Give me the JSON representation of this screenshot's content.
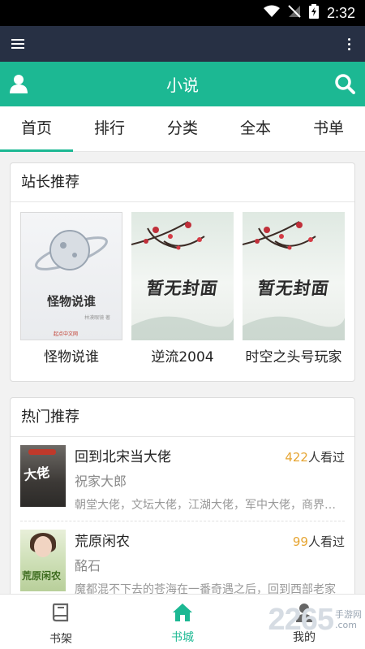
{
  "status_bar": {
    "time": "2:32"
  },
  "header": {
    "title": "小说"
  },
  "tabs": [
    {
      "label": "首页",
      "active": true
    },
    {
      "label": "排行",
      "active": false
    },
    {
      "label": "分类",
      "active": false
    },
    {
      "label": "全本",
      "active": false
    },
    {
      "label": "书单",
      "active": false
    }
  ],
  "recommend": {
    "title": "站长推荐",
    "books": [
      {
        "name": "怪物说谁",
        "cover_title": "怪物说谁",
        "cover_author": "林漠眼镜 著",
        "cover_publisher": "起点中文网"
      },
      {
        "name": "逆流2004",
        "cover_text": "暂无封面"
      },
      {
        "name": "时空之头号玩家",
        "cover_text": "暂无封面"
      }
    ]
  },
  "hot": {
    "title": "热门推荐",
    "items": [
      {
        "title": "回到北宋当大佬",
        "count": "422",
        "count_suffix": "人看过",
        "author": "祝家大郎",
        "desc": "朝堂大佬，文坛大佬，江湖大佬，军中大佬，商界大佬",
        "cover_text": "大佬"
      },
      {
        "title": "荒原闲农",
        "count": "99",
        "count_suffix": "人看过",
        "author": "酩石",
        "desc": "魔都混不下去的苍海在一番奇遇之后，回到西部老家",
        "cover_text": "荒原闲农"
      }
    ]
  },
  "bottom_nav": [
    {
      "label": "书架",
      "icon": "book-icon",
      "active": false
    },
    {
      "label": "书城",
      "icon": "home-icon",
      "active": true
    },
    {
      "label": "我的",
      "icon": "person-icon",
      "active": false
    }
  ],
  "watermark": {
    "number": "2265",
    "line1": "手游网",
    "line2": ".com"
  },
  "colors": {
    "accent": "#1cb893",
    "appbar": "#273044",
    "count": "#e6a532"
  }
}
